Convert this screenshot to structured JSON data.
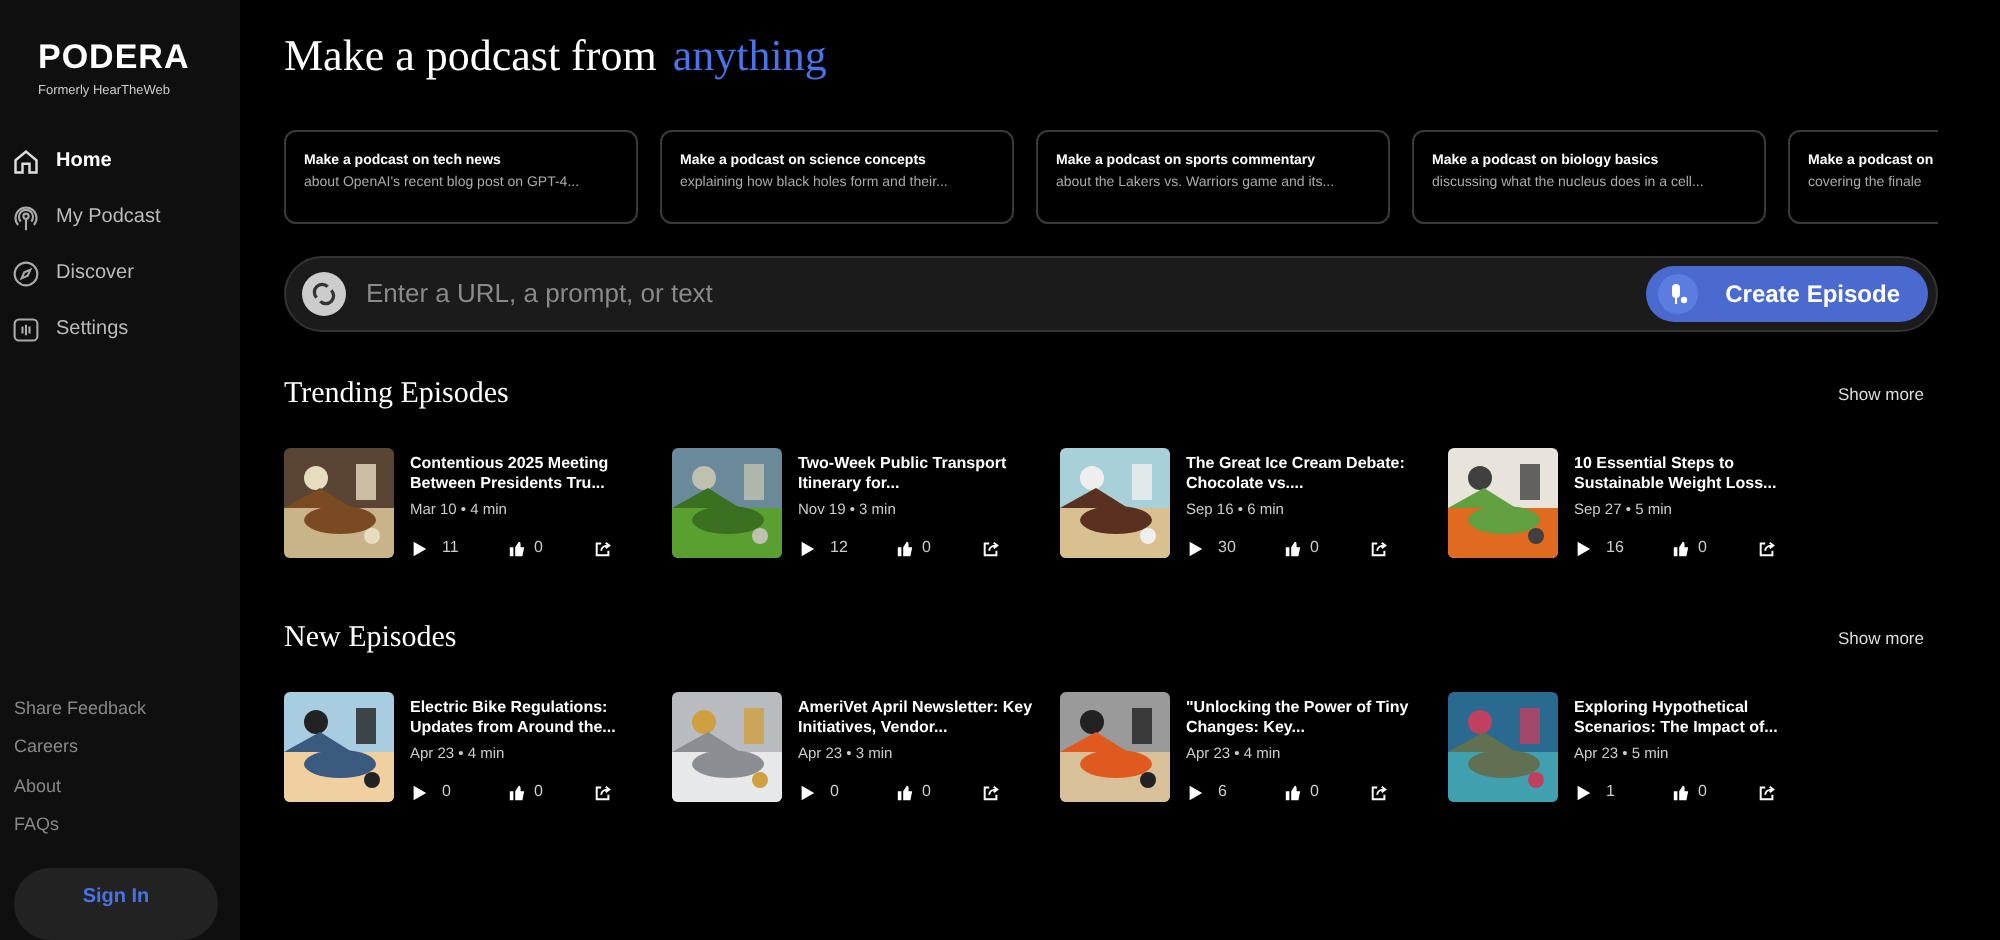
{
  "brand": {
    "name": "PODERA",
    "tagline": "Formerly HearTheWeb"
  },
  "nav": [
    {
      "label": "Home",
      "selected": true
    },
    {
      "label": "My Podcast",
      "selected": false
    },
    {
      "label": "Discover",
      "selected": false
    },
    {
      "label": "Settings",
      "selected": false
    }
  ],
  "footer_links": [
    "Share Feedback",
    "Careers",
    "About",
    "FAQs"
  ],
  "sign_in": "Sign In",
  "headline": {
    "text": "Make a podcast from",
    "highlight": "anything"
  },
  "suggestions": [
    {
      "title": "Make a podcast on tech news",
      "subtitle": "about OpenAI's recent blog post on GPT-4..."
    },
    {
      "title": "Make a podcast on science concepts",
      "subtitle": "explaining how black holes form and their..."
    },
    {
      "title": "Make a podcast on sports commentary",
      "subtitle": "about the Lakers vs. Warriors game and its..."
    },
    {
      "title": "Make a podcast on biology basics",
      "subtitle": "discussing what the nucleus does in a cell..."
    },
    {
      "title": "Make a podcast on",
      "subtitle": "covering the finale"
    }
  ],
  "prompt": {
    "placeholder": "Enter a URL, a prompt, or text",
    "button": "Create Episode"
  },
  "sections": [
    {
      "title": "Trending Episodes",
      "more": "Show more",
      "episodes": [
        {
          "title": "Contentious 2025 Meeting Between Presidents Tru...",
          "meta": "Mar 10 • 4 min",
          "plays": "11",
          "likes": "0"
        },
        {
          "title": "Two-Week Public Transport Itinerary for...",
          "meta": "Nov 19 • 3 min",
          "plays": "12",
          "likes": "0"
        },
        {
          "title": "The Great Ice Cream Debate: Chocolate vs....",
          "meta": "Sep 16 • 6 min",
          "plays": "30",
          "likes": "0"
        },
        {
          "title": "10 Essential Steps to Sustainable Weight Loss...",
          "meta": "Sep 27 • 5 min",
          "plays": "16",
          "likes": "0"
        }
      ]
    },
    {
      "title": "New Episodes",
      "more": "Show more",
      "episodes": [
        {
          "title": "Electric Bike Regulations: Updates from Around the...",
          "meta": "Apr 23 • 4 min",
          "plays": "0",
          "likes": "0"
        },
        {
          "title": "AmeriVet April Newsletter: Key Initiatives, Vendor...",
          "meta": "Apr 23 • 3 min",
          "plays": "0",
          "likes": "0"
        },
        {
          "title": "\"Unlocking the Power of Tiny Changes: Key...",
          "meta": "Apr 23 • 4 min",
          "plays": "6",
          "likes": "0"
        },
        {
          "title": "Exploring Hypothetical Scenarios: The Impact of...",
          "meta": "Apr 23 • 5 min",
          "plays": "1",
          "likes": "0"
        }
      ]
    }
  ]
}
